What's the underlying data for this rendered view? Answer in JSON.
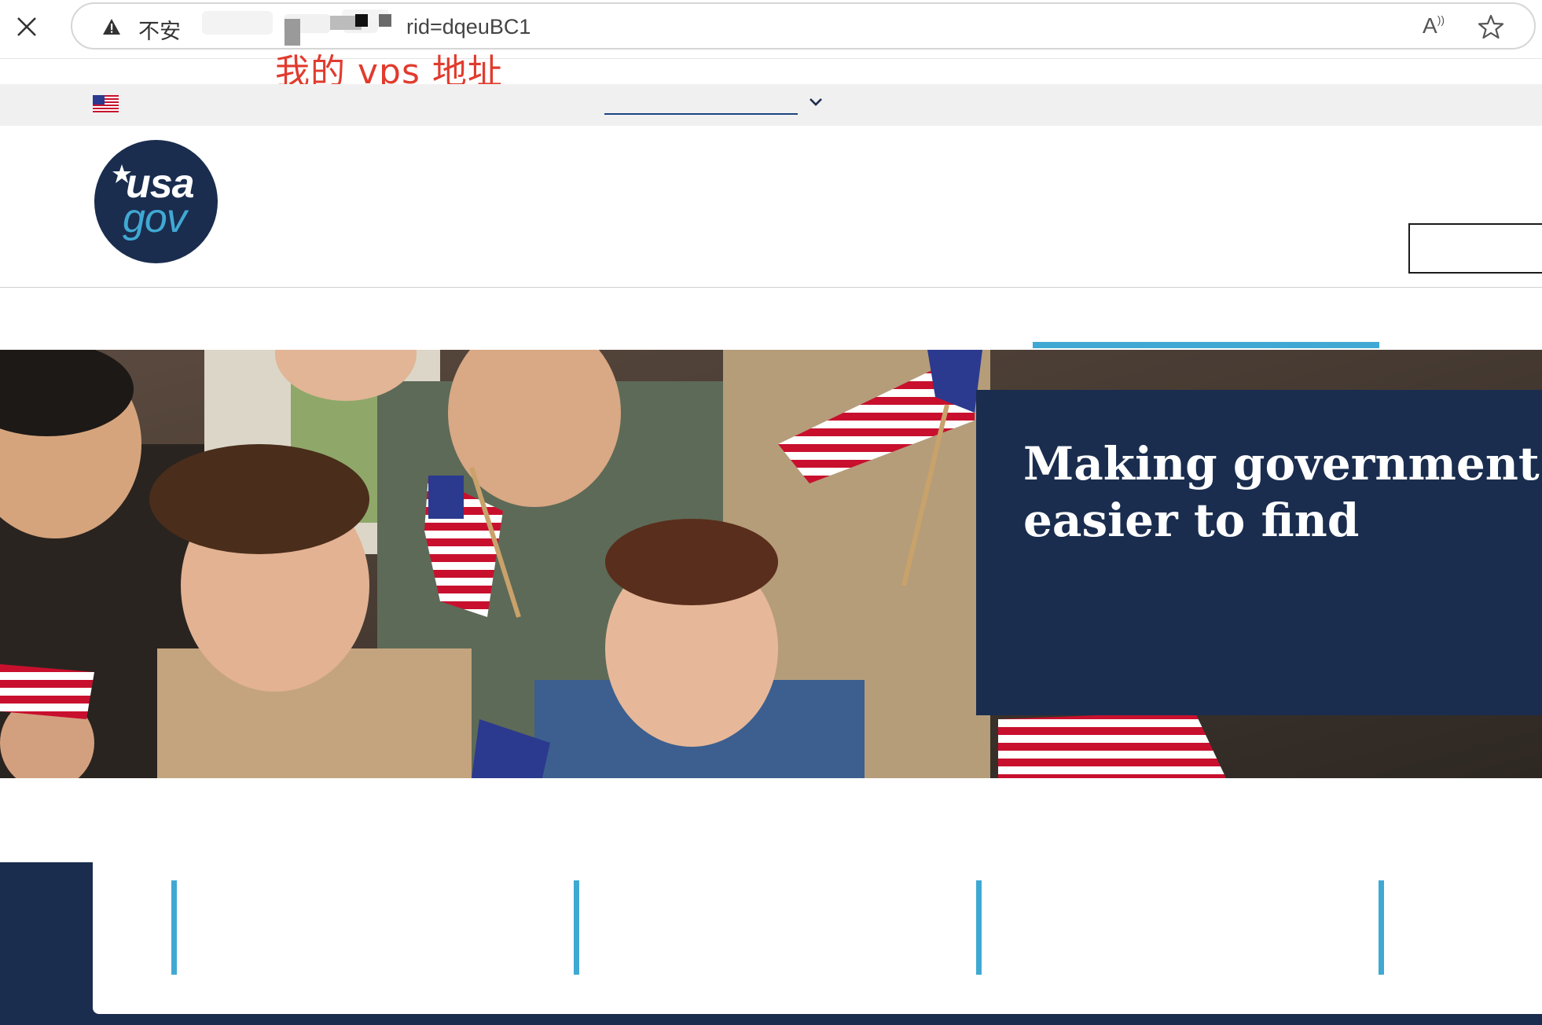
{
  "browser": {
    "security_label": "不安",
    "url_visible": "rid=dqeuBC1",
    "read_aloud_label": "A",
    "read_aloud_mark": "))"
  },
  "annotation": {
    "text": "我的 vps 地址",
    "color": "#e13b2e"
  },
  "site": {
    "logo": {
      "line1": "usa",
      "line2": "gov"
    },
    "hero_title_line1": "Making government",
    "hero_title_line2": "easier to find",
    "colors": {
      "navy": "#1a2d4f",
      "accent": "#40a9d3",
      "banner_bg": "#f0f0f0",
      "lang_underline": "#1a4480"
    }
  },
  "icons": [
    "close-icon",
    "warning-icon",
    "read-aloud-icon",
    "favorite-star-icon",
    "us-flag-icon",
    "chevron-down-icon"
  ]
}
